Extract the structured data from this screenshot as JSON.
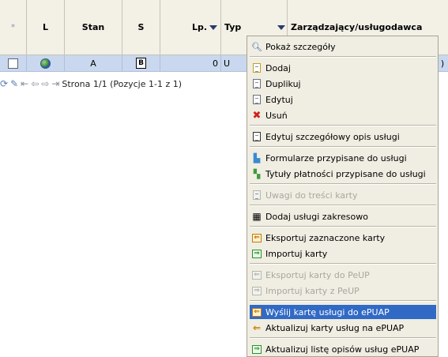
{
  "header": {
    "col_star": "*",
    "col_l": "L",
    "col_stan": "Stan",
    "col_s": "S",
    "col_lp": "Lp.",
    "col_typ": "Typ",
    "col_zarz": "Zarządzający/usługodawca"
  },
  "row": {
    "stan": "A",
    "s_icon_letter": "B",
    "lp": "0",
    "typ": "U",
    "tail": ")"
  },
  "pager": {
    "text": "Strona 1/1 (Pozycje 1-1 z 1)"
  },
  "menu": {
    "items": [
      {
        "label": "Pokaż szczegóły",
        "icon": "magnifier-icon"
      },
      {
        "label": "Dodaj",
        "icon": "new-document-icon"
      },
      {
        "label": "Duplikuj",
        "icon": "duplicate-icon"
      },
      {
        "label": "Edytuj",
        "icon": "edit-document-icon"
      },
      {
        "label": "Usuń",
        "icon": "delete-x-icon"
      },
      {
        "label": "Edytuj szczegółowy opis usługi",
        "icon": "description-icon"
      },
      {
        "label": "Formularze przypisane do usługi",
        "icon": "forms-icon"
      },
      {
        "label": "Tytuły płatności przypisane do usługi",
        "icon": "payments-icon"
      },
      {
        "label": "Uwagi do treści karty",
        "icon": "notes-icon"
      },
      {
        "label": "Dodaj usługi zakresowo",
        "icon": "grid-icon"
      },
      {
        "label": "Eksportuj zaznaczone karty",
        "icon": "export-icon"
      },
      {
        "label": "Importuj karty",
        "icon": "import-icon"
      },
      {
        "label": "Eksportuj karty do PeUP",
        "icon": "export-peup-icon"
      },
      {
        "label": "Importuj karty z PeUP",
        "icon": "import-peup-icon"
      },
      {
        "label": "Wyślij kartę usługi do ePUAP",
        "icon": "send-epuap-icon"
      },
      {
        "label": "Aktualizuj karty usług na ePUAP",
        "icon": "arrow-left-icon"
      },
      {
        "label": "Aktualizuj listę opisów usług ePUAP",
        "icon": "update-list-icon"
      }
    ]
  },
  "colors": {
    "highlight": "#316ac5",
    "row_selected": "#c9d8ee",
    "menu_bg": "#f0ede2",
    "header_bg": "#f3f0e6"
  }
}
